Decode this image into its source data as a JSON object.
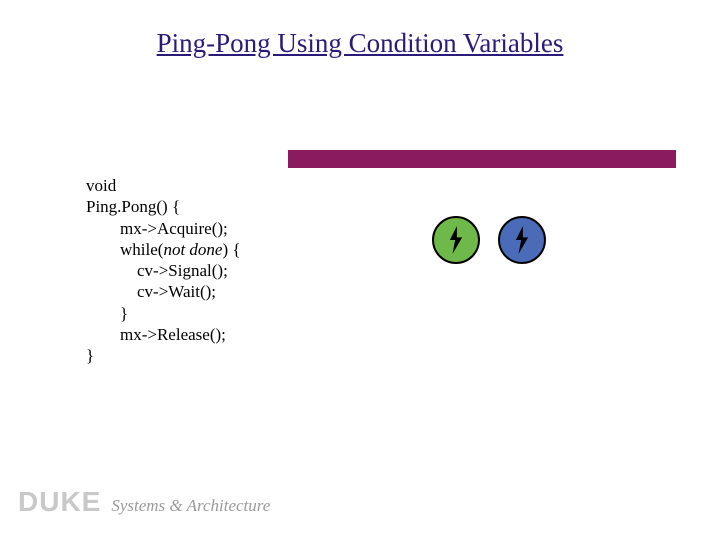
{
  "title": "Ping-Pong Using Condition Variables",
  "code": {
    "l1": "void",
    "l2": "Ping.Pong() {",
    "l3": "        mx->Acquire();",
    "l4a": "        while(",
    "l4b": "not done",
    "l4c": ") {",
    "l5": "            cv->Signal();",
    "l6": "            cv->Wait();",
    "l7": "        }",
    "l8": "        mx->Release();",
    "l9": "}"
  },
  "footer": {
    "duke": "DUKE",
    "sa": "Systems & Architecture"
  },
  "icons": {
    "left": "lightning-bolt",
    "right": "lightning-bolt"
  }
}
